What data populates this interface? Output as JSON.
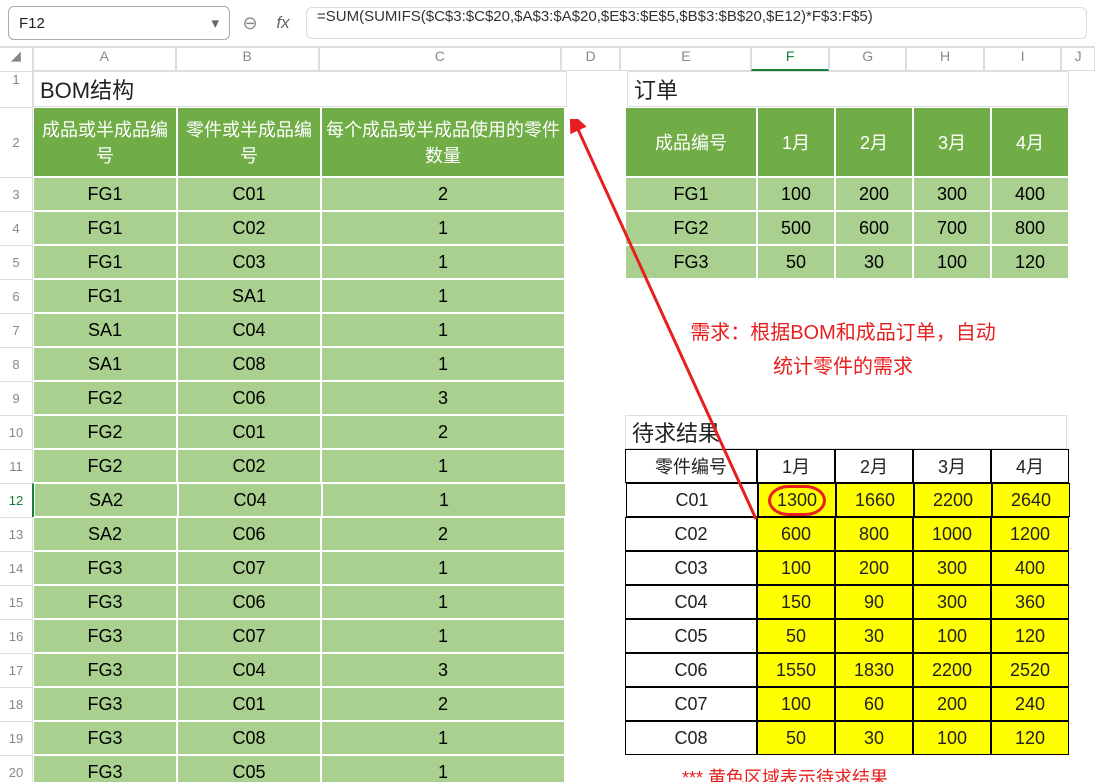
{
  "namebox": "F12",
  "formula": "=SUM(SUMIFS($C$3:$C$20,$A$3:$A$20,$E$3:$E$5,$B$3:$B$20,$E12)*F$3:F$5)",
  "colHeaders": [
    "A",
    "B",
    "C",
    "D",
    "E",
    "F",
    "G",
    "H",
    "I",
    "J"
  ],
  "bom": {
    "title": "BOM结构",
    "headers": [
      "成品或半成品编号",
      "零件或半成品编号",
      "每个成品或半成品使用的零件数量"
    ],
    "rows": [
      [
        "FG1",
        "C01",
        "2"
      ],
      [
        "FG1",
        "C02",
        "1"
      ],
      [
        "FG1",
        "C03",
        "1"
      ],
      [
        "FG1",
        "SA1",
        "1"
      ],
      [
        "SA1",
        "C04",
        "1"
      ],
      [
        "SA1",
        "C08",
        "1"
      ],
      [
        "FG2",
        "C06",
        "3"
      ],
      [
        "FG2",
        "C01",
        "2"
      ],
      [
        "FG2",
        "C02",
        "1"
      ],
      [
        "SA2",
        "C04",
        "1"
      ],
      [
        "SA2",
        "C06",
        "2"
      ],
      [
        "FG3",
        "C07",
        "1"
      ],
      [
        "FG3",
        "C06",
        "1"
      ],
      [
        "FG3",
        "C07",
        "1"
      ],
      [
        "FG3",
        "C04",
        "3"
      ],
      [
        "FG3",
        "C01",
        "2"
      ],
      [
        "FG3",
        "C08",
        "1"
      ],
      [
        "FG3",
        "C05",
        "1"
      ]
    ]
  },
  "orders": {
    "title": "订单",
    "headers": [
      "成品编号",
      "1月",
      "2月",
      "3月",
      "4月"
    ],
    "rows": [
      [
        "FG1",
        "100",
        "200",
        "300",
        "400"
      ],
      [
        "FG2",
        "500",
        "600",
        "700",
        "800"
      ],
      [
        "FG3",
        "50",
        "30",
        "100",
        "120"
      ]
    ]
  },
  "noteLines": [
    "需求：根据BOM和成品订单，自动",
    "统计零件的需求"
  ],
  "result": {
    "title": "待求结果",
    "headers": [
      "零件编号",
      "1月",
      "2月",
      "3月",
      "4月"
    ],
    "rows": [
      [
        "C01",
        "1300",
        "1660",
        "2200",
        "2640"
      ],
      [
        "C02",
        "600",
        "800",
        "1000",
        "1200"
      ],
      [
        "C03",
        "100",
        "200",
        "300",
        "400"
      ],
      [
        "C04",
        "150",
        "90",
        "300",
        "360"
      ],
      [
        "C05",
        "50",
        "30",
        "100",
        "120"
      ],
      [
        "C06",
        "1550",
        "1830",
        "2200",
        "2520"
      ],
      [
        "C07",
        "100",
        "60",
        "200",
        "240"
      ],
      [
        "C08",
        "50",
        "30",
        "100",
        "120"
      ]
    ]
  },
  "footnote": "*** 黄色区域表示待求结果",
  "chart_data": [
    {
      "type": "table",
      "title": "BOM结构",
      "columns": [
        "成品或半成品编号",
        "零件或半成品编号",
        "每个成品或半成品使用的零件数量"
      ],
      "rows": [
        [
          "FG1",
          "C01",
          2
        ],
        [
          "FG1",
          "C02",
          1
        ],
        [
          "FG1",
          "C03",
          1
        ],
        [
          "FG1",
          "SA1",
          1
        ],
        [
          "SA1",
          "C04",
          1
        ],
        [
          "SA1",
          "C08",
          1
        ],
        [
          "FG2",
          "C06",
          3
        ],
        [
          "FG2",
          "C01",
          2
        ],
        [
          "FG2",
          "C02",
          1
        ],
        [
          "SA2",
          "C04",
          1
        ],
        [
          "SA2",
          "C06",
          2
        ],
        [
          "FG3",
          "C07",
          1
        ],
        [
          "FG3",
          "C06",
          1
        ],
        [
          "FG3",
          "C07",
          1
        ],
        [
          "FG3",
          "C04",
          3
        ],
        [
          "FG3",
          "C01",
          2
        ],
        [
          "FG3",
          "C08",
          1
        ],
        [
          "FG3",
          "C05",
          1
        ]
      ]
    },
    {
      "type": "table",
      "title": "订单",
      "columns": [
        "成品编号",
        "1月",
        "2月",
        "3月",
        "4月"
      ],
      "rows": [
        [
          "FG1",
          100,
          200,
          300,
          400
        ],
        [
          "FG2",
          500,
          600,
          700,
          800
        ],
        [
          "FG3",
          50,
          30,
          100,
          120
        ]
      ]
    },
    {
      "type": "table",
      "title": "待求结果",
      "columns": [
        "零件编号",
        "1月",
        "2月",
        "3月",
        "4月"
      ],
      "rows": [
        [
          "C01",
          1300,
          1660,
          2200,
          2640
        ],
        [
          "C02",
          600,
          800,
          1000,
          1200
        ],
        [
          "C03",
          100,
          200,
          300,
          400
        ],
        [
          "C04",
          150,
          90,
          300,
          360
        ],
        [
          "C05",
          50,
          30,
          100,
          120
        ],
        [
          "C06",
          1550,
          1830,
          2200,
          2520
        ],
        [
          "C07",
          100,
          60,
          200,
          240
        ],
        [
          "C08",
          50,
          30,
          100,
          120
        ]
      ]
    }
  ]
}
